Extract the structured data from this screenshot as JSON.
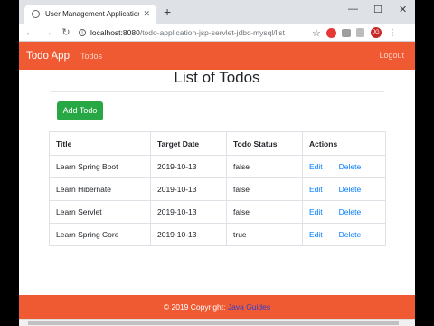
{
  "browser": {
    "tab_title": "User Management Application",
    "tab_close": "✕",
    "new_tab": "+",
    "win_minimize": "—",
    "win_maximize": "☐",
    "win_close": "✕",
    "back": "←",
    "forward": "→",
    "reload": "↻",
    "url_host": "localhost:8080",
    "url_path": "/todo-application-jsp-servlet-jdbc-mysql/list",
    "star": "☆",
    "avatar_text": "JG",
    "menu": "⋮"
  },
  "appnav": {
    "brand": "Todo App",
    "todos_link": "Todos",
    "logout_link": "Logout"
  },
  "page": {
    "heading": "List of Todos",
    "add_button": "Add Todo"
  },
  "table": {
    "headers": [
      "Title",
      "Target Date",
      "Todo Status",
      "Actions"
    ],
    "rows": [
      {
        "title": "Learn Spring Boot",
        "date": "2019-10-13",
        "status": "false",
        "edit": "Edit",
        "delete": "Delete"
      },
      {
        "title": "Learn Hibernate",
        "date": "2019-10-13",
        "status": "false",
        "edit": "Edit",
        "delete": "Delete"
      },
      {
        "title": "Learn Servlet",
        "date": "2019-10-13",
        "status": "false",
        "edit": "Edit",
        "delete": "Delete"
      },
      {
        "title": "Learn Spring Core",
        "date": "2019-10-13",
        "status": "true",
        "edit": "Edit",
        "delete": "Delete"
      }
    ]
  },
  "footer": {
    "text": "© 2019 Copyright: ",
    "link": "Java Guides"
  },
  "colors": {
    "navbar": "#f05a33",
    "add_button": "#28a745",
    "link": "#007bff"
  }
}
